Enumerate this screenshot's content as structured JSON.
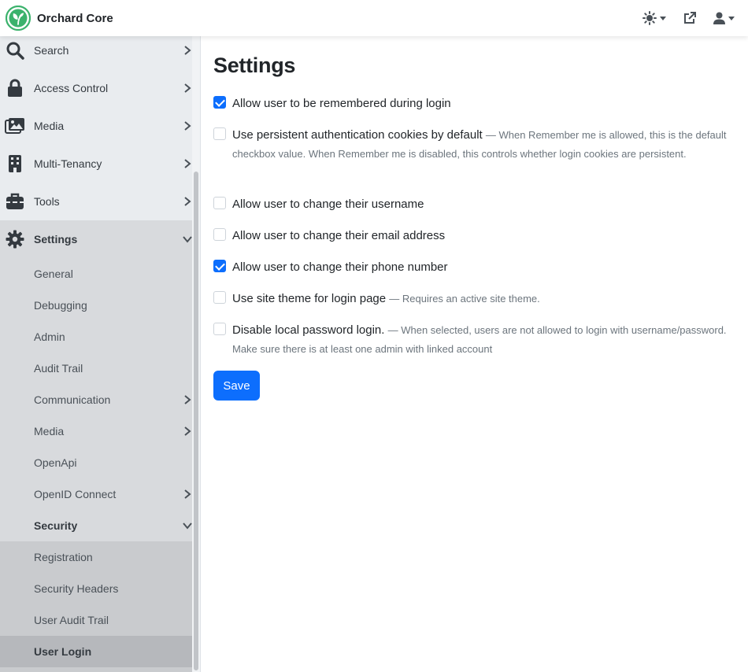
{
  "brand": {
    "name": "Orchard Core"
  },
  "topbar": {
    "theme_icon": "sun-icon",
    "external_icon": "external-link-icon",
    "user_icon": "user-icon"
  },
  "sidebar": {
    "items": [
      {
        "label": "Search",
        "icon": "search-icon"
      },
      {
        "label": "Access Control",
        "icon": "lock-icon"
      },
      {
        "label": "Media",
        "icon": "images-icon"
      },
      {
        "label": "Multi-Tenancy",
        "icon": "building-icon"
      },
      {
        "label": "Tools",
        "icon": "toolbox-icon"
      },
      {
        "label": "Settings",
        "icon": "gear-icon"
      }
    ],
    "settings_children": [
      {
        "label": "General"
      },
      {
        "label": "Debugging"
      },
      {
        "label": "Admin"
      },
      {
        "label": "Audit Trail"
      },
      {
        "label": "Communication"
      },
      {
        "label": "Media"
      },
      {
        "label": "OpenApi"
      },
      {
        "label": "OpenID Connect"
      },
      {
        "label": "Security"
      }
    ],
    "security_children": [
      {
        "label": "Registration"
      },
      {
        "label": "Security Headers"
      },
      {
        "label": "User Audit Trail"
      },
      {
        "label": "User Login"
      }
    ]
  },
  "main": {
    "title": "Settings",
    "options": [
      {
        "label": "Allow user to be remembered during login",
        "hint": "",
        "checked": true
      },
      {
        "label": "Use persistent authentication cookies by default",
        "hint": "— When Remember me is allowed, this is the default checkbox value. When Remember me is disabled, this controls whether login cookies are persistent.",
        "checked": false
      },
      {
        "label": "Allow user to change their username",
        "hint": "",
        "checked": false
      },
      {
        "label": "Allow user to change their email address",
        "hint": "",
        "checked": false
      },
      {
        "label": "Allow user to change their phone number",
        "hint": "",
        "checked": true
      },
      {
        "label": "Use site theme for login page",
        "hint": "— Requires an active site theme.",
        "checked": false
      },
      {
        "label": "Disable local password login.",
        "hint": "— When selected, users are not allowed to login with username/password. Make sure there is at least one admin with linked account",
        "checked": false
      }
    ],
    "save_label": "Save"
  },
  "colors": {
    "primary": "#0d6efd",
    "logo_green": "#3bb26c",
    "sidebar_bg": "#e9ecef"
  }
}
